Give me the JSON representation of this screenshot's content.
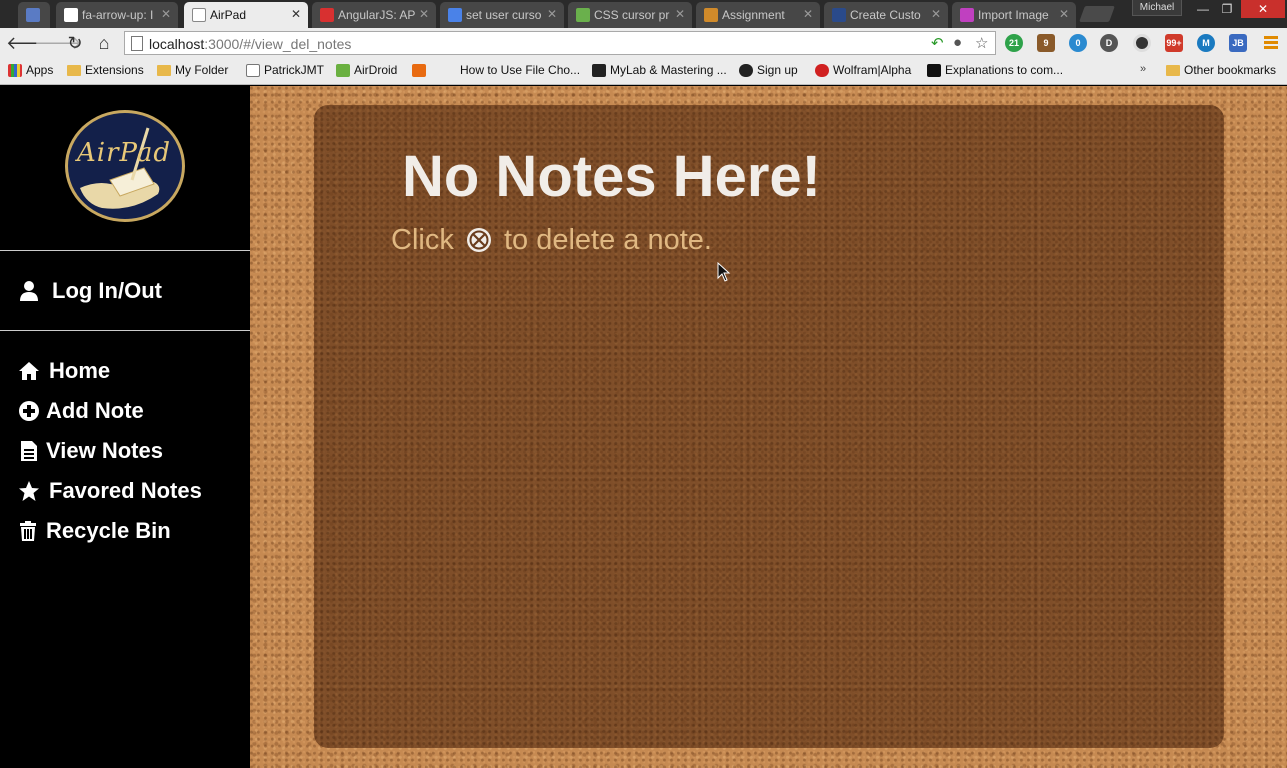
{
  "browser": {
    "profile_name": "Michael",
    "window_controls": {
      "minimize": "—",
      "restore": "❐",
      "close": "✕"
    },
    "tabs": [
      {
        "title": "",
        "favicon": "page-icon",
        "color": "#5a7bc4"
      },
      {
        "title": "fa-arrow-up: I",
        "favicon": "flag-icon",
        "color": "#ffffff"
      },
      {
        "title": "AirPad",
        "favicon": "document-icon",
        "color": "#ffffff",
        "active": true
      },
      {
        "title": "AngularJS: AP",
        "favicon": "angular-icon",
        "color": "#d83030"
      },
      {
        "title": "set user curso",
        "favicon": "google-icon",
        "color": "#4a82e8"
      },
      {
        "title": "CSS cursor pr",
        "favicon": "w3-icon",
        "color": "#6ab04c"
      },
      {
        "title": "Assignment",
        "favicon": "assignment-icon",
        "color": "#d08a2a"
      },
      {
        "title": "Create Custo",
        "favicon": "hg-icon",
        "color": "#2a4a8a"
      },
      {
        "title": "Import Image",
        "favicon": "image-icon",
        "color": "#c040c0"
      }
    ],
    "url": {
      "host": "localhost",
      "path": ":3000/#/view_del_notes"
    },
    "extensions": [
      {
        "name": "evernote-icon",
        "badge": "21",
        "color": "#2ea24a"
      },
      {
        "name": "stack-icon",
        "badge": "9",
        "color": "#8a5a2a"
      },
      {
        "name": "ghostery-icon",
        "badge": "0",
        "color": "#2a8ad0"
      },
      {
        "name": "d-icon",
        "badge": "",
        "color": "#555555"
      },
      {
        "name": "circle-icon",
        "badge": "",
        "color": "#333333"
      },
      {
        "name": "gmail-icon",
        "badge": "99+",
        "color": "#d03a2a"
      },
      {
        "name": "m-icon",
        "badge": "M",
        "color": "#1a7ac0"
      },
      {
        "name": "jb-icon",
        "badge": "JB",
        "color": "#3a6ac0"
      }
    ],
    "bookmarks": [
      {
        "label": "Apps",
        "icon": "apps-grid-icon"
      },
      {
        "label": "Extensions",
        "icon": "folder-icon"
      },
      {
        "label": "My Folder",
        "icon": "folder-icon"
      },
      {
        "label": "PatrickJMT",
        "icon": "page-icon"
      },
      {
        "label": "AirDroid",
        "icon": "airdroid-icon"
      },
      {
        "label": "",
        "icon": "blogger-icon"
      },
      {
        "label": "How to Use File Cho...",
        "icon": "none"
      },
      {
        "label": "MyLab & Mastering ...",
        "icon": "p-icon"
      },
      {
        "label": "Sign up",
        "icon": "github-icon"
      },
      {
        "label": "Wolfram|Alpha",
        "icon": "wolfram-icon"
      },
      {
        "label": "Explanations to com...",
        "icon": "qr-icon"
      },
      {
        "label": "Other bookmarks",
        "icon": "folder-icon"
      }
    ],
    "bookmarks_overflow": "»"
  },
  "sidebar": {
    "logo_text": "AirPad",
    "login_label": "Log In/Out",
    "nav": [
      {
        "label": "Home",
        "icon": "home-icon"
      },
      {
        "label": "Add Note",
        "icon": "plus-circle-icon"
      },
      {
        "label": "View Notes",
        "icon": "file-text-icon"
      },
      {
        "label": "Favored Notes",
        "icon": "star-icon"
      },
      {
        "label": "Recycle Bin",
        "icon": "trash-icon"
      }
    ]
  },
  "main": {
    "heading": "No Notes Here!",
    "hint_before": "Click",
    "hint_icon": "delete-circle-icon",
    "hint_after": "to delete a note."
  },
  "colors": {
    "sidebar_bg": "#000000",
    "cork": "#c68a52",
    "panel": "#643719",
    "heading": "#f1ede8",
    "hint": "#e0b882"
  }
}
